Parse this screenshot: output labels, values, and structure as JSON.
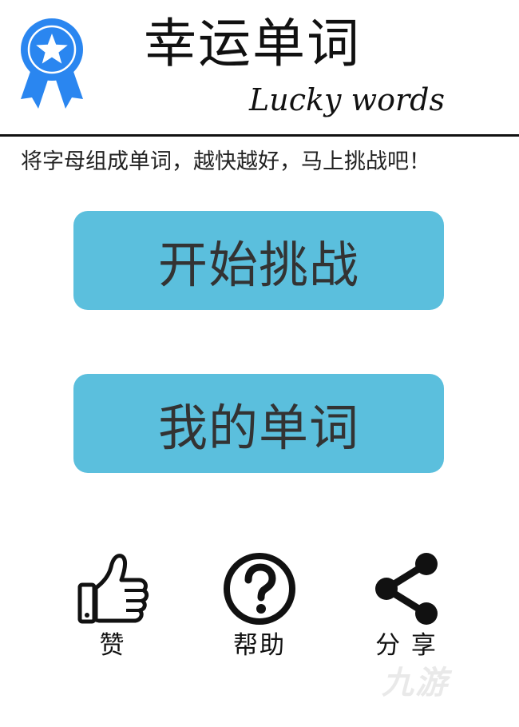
{
  "header": {
    "title_cn": "幸运单词",
    "title_en": "Lucky words",
    "logo_icon": "award-ribbon-star-icon",
    "logo_color": "#2a86f0"
  },
  "tagline": "将字母组成单词，越快越好，马上挑战吧！",
  "buttons": {
    "start_label": "开始挑战",
    "my_words_label": "我的单词",
    "color": "#5bbfdd"
  },
  "actions": [
    {
      "label": "赞",
      "icon": "thumbs-up-icon"
    },
    {
      "label": "帮助",
      "icon": "help-circle-icon"
    },
    {
      "label": "分 享",
      "icon": "share-icon"
    }
  ],
  "watermark": "九游"
}
